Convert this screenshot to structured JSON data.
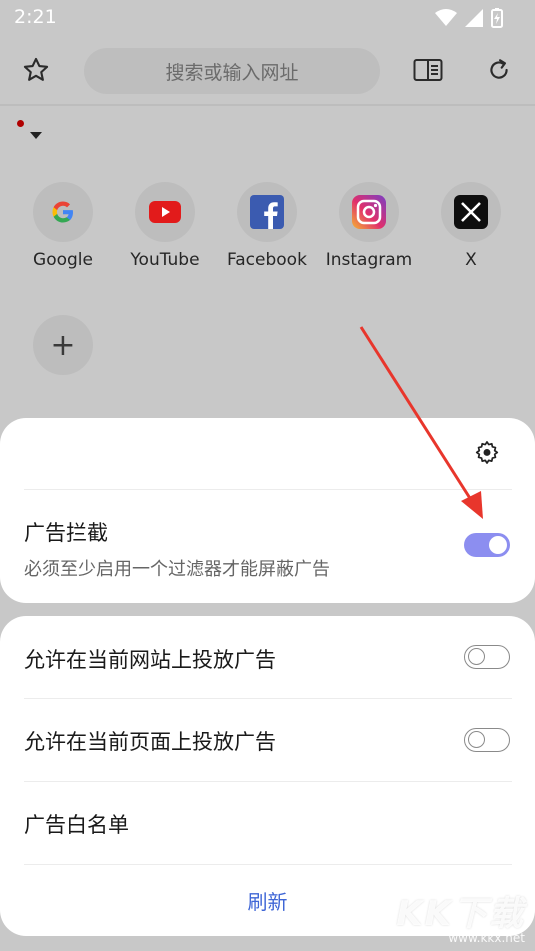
{
  "status_bar": {
    "time": "2:21"
  },
  "toolbar": {
    "search_placeholder": "搜索或输入网址"
  },
  "shortcuts": [
    {
      "label": "Google",
      "icon": "google-icon"
    },
    {
      "label": "YouTube",
      "icon": "youtube-icon"
    },
    {
      "label": "Facebook",
      "icon": "facebook-icon"
    },
    {
      "label": "Instagram",
      "icon": "instagram-icon"
    },
    {
      "label": "X",
      "icon": "x-icon"
    }
  ],
  "ad_block_sheet": {
    "title": "广告拦截",
    "subtitle": "必须至少启用一个过滤器才能屏蔽广告",
    "enabled": true,
    "options": [
      {
        "label": "允许在当前网站上投放广告",
        "enabled": false
      },
      {
        "label": "允许在当前页面上投放广告",
        "enabled": false
      }
    ],
    "whitelist_label": "广告白名单",
    "refresh_label": "刷新"
  },
  "watermark": {
    "logo": "KK下载",
    "url": "www.kkx.net"
  },
  "colors": {
    "accent": "#8c8ef0",
    "link": "#3f66d6",
    "annotation_arrow": "#e8362c"
  }
}
